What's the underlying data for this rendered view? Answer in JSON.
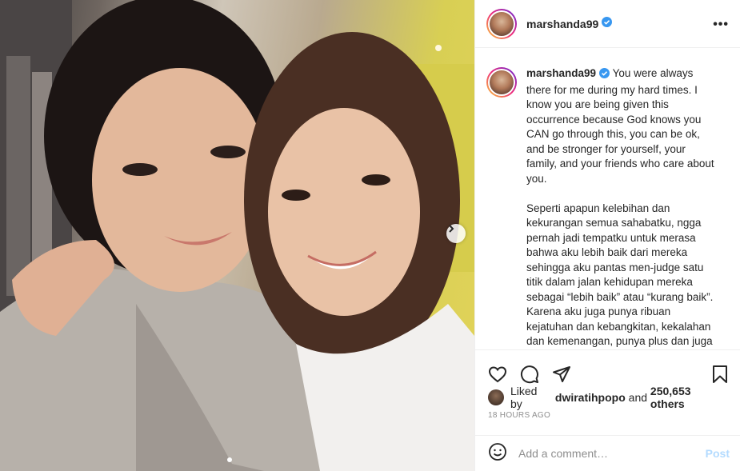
{
  "post": {
    "username": "marshanda99",
    "caption_paragraphs": [
      "You were always there for me during my hard times. I know you are being given this occurrence because God knows you CAN go through this, you can be ok, and be stronger for yourself, your family, and your friends who care about you.",
      "Seperti apapun kelebihan dan kekurangan semua sahabatku, ngga pernah jadi tempatku untuk merasa bahwa aku lebih baik dari mereka sehingga aku pantas men-judge satu titik dalam jalan kehidupan mereka sebagai “lebih baik” atau “kurang baik”. Karena aku juga punya ribuan kejatuhan dan kebangkitan, kekalahan dan kemenangan, punya plus dan juga"
    ],
    "likes": {
      "prefix": "Liked by",
      "user": "dwiratihpopo",
      "connector": "and",
      "count": "250,653 others"
    },
    "timestamp": "18 HOURS AGO"
  },
  "comment": {
    "placeholder": "Add a comment…",
    "post_label": "Post"
  },
  "colors": {
    "verified": "#3897f0",
    "post_disabled": "#b3dbff",
    "meta": "#8e8e8e"
  },
  "icons": [
    "more-options-icon",
    "verified-badge-icon",
    "heart-icon",
    "comment-icon",
    "share-icon",
    "bookmark-icon",
    "emoji-icon",
    "chevron-right-icon"
  ]
}
